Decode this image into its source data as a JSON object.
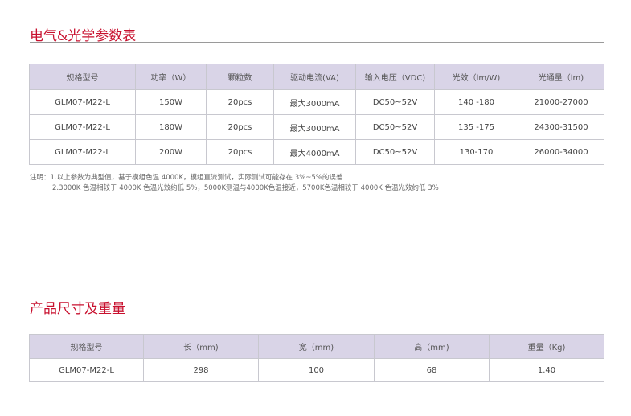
{
  "section1": {
    "title": "电气&光学参数表",
    "headers": [
      "规格型号",
      "功率（W）",
      "颗粒数",
      "驱动电流(VA)",
      "输入电压（VDC)",
      "光效（lm/W)",
      "光通量（lm)"
    ],
    "rows": [
      [
        "GLM07-M22-L",
        "150W",
        "20pcs",
        "最大3000mA",
        "DC50~52V",
        "140 -180",
        "21000-27000"
      ],
      [
        "GLM07-M22-L",
        "180W",
        "20pcs",
        "最大3000mA",
        "DC50~52V",
        "135 -175",
        "24300-31500"
      ],
      [
        "GLM07-M22-L",
        "200W",
        "20pcs",
        "最大4000mA",
        "DC50~52V",
        "130-170",
        "26000-34000"
      ]
    ]
  },
  "notes": {
    "line1": "注明：1.以上参数为典型值，基于模组色温 4000K，模组直流测试，实际测试可能存在 3%~5%的误差",
    "line2": "2.3000K 色温相较于 4000K 色温光效约低 5%，5000K测温与4000K色温接近，5700K色温相较于 4000K 色温光效约低 3%"
  },
  "section2": {
    "title": "产品尺寸及重量",
    "headers": [
      "规格型号",
      "长（mm)",
      "宽（mm)",
      "高（mm)",
      "重量（Kg)"
    ],
    "rows": [
      [
        "GLM07-M22-L",
        "298",
        "100",
        "68",
        "1.40"
      ]
    ]
  }
}
